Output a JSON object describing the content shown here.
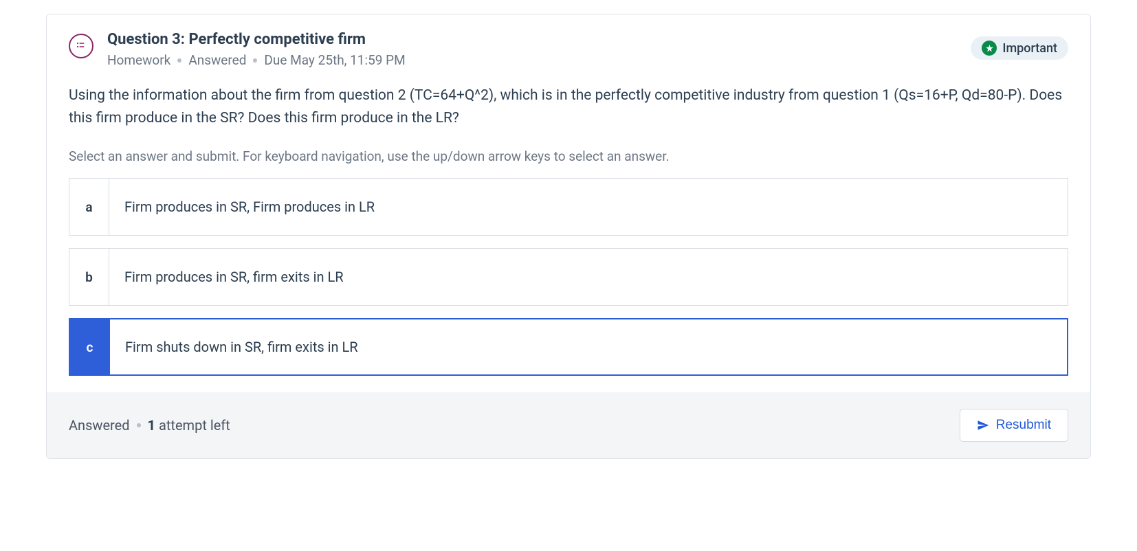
{
  "header": {
    "title": "Question 3: Perfectly competitive firm",
    "meta_type": "Homework",
    "meta_status": "Answered",
    "meta_due": "Due May 25th, 11:59 PM",
    "badge_label": "Important"
  },
  "body": {
    "question_text": "Using the information about the firm from question 2 (TC=64+Q^2), which is in the perfectly competitive industry from question 1 (Qs=16+P, Qd=80-P). Does this firm produce in the SR? Does this firm produce in the LR?",
    "instruction": "Select an answer and submit. For keyboard navigation, use the up/down arrow keys to select an answer.",
    "options": [
      {
        "key": "a",
        "text": "Firm produces in SR, Firm produces in LR",
        "selected": false
      },
      {
        "key": "b",
        "text": "Firm produces in SR, firm exits in LR",
        "selected": false
      },
      {
        "key": "c",
        "text": "Firm shuts down in SR, firm exits in LR",
        "selected": true
      }
    ]
  },
  "footer": {
    "status_label": "Answered",
    "attempts_num": "1",
    "attempts_label": "attempt left",
    "resubmit_label": "Resubmit"
  }
}
